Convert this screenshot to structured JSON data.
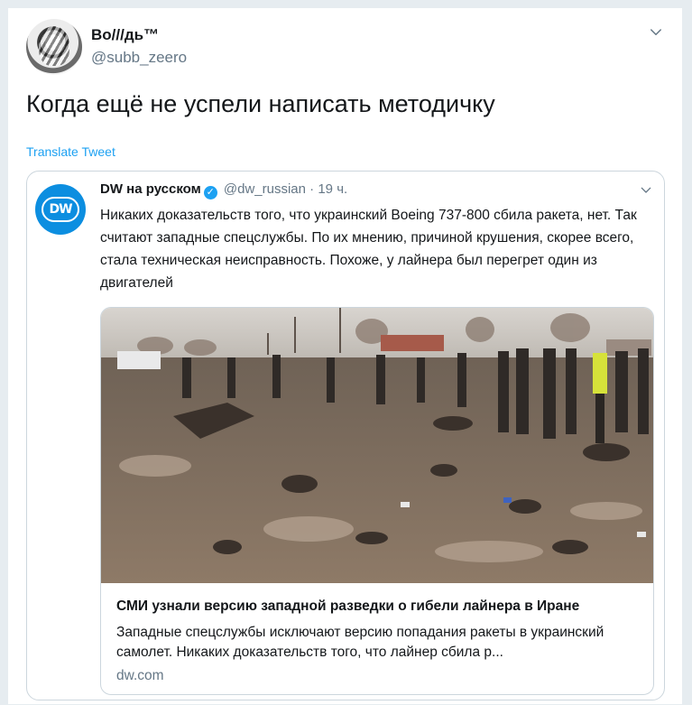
{
  "user": {
    "display_name": "Во///дь™",
    "handle": "@subb_zeero"
  },
  "tweet": {
    "text": "Когда ещё не успели написать методичку",
    "translate_label": "Translate Tweet"
  },
  "quoted": {
    "name": "DW на русском",
    "handle": "@dw_russian",
    "separator": "·",
    "time": "19 ч.",
    "avatar_text": "DW",
    "text": "Никаких доказательств того, что украинский Boeing 737-800 сбила ракета, нет. Так считают западные спецслужбы. По их мнению, причиной крушения, скорее всего, стала техническая неисправность. Похоже, у лайнера был перегрет один из двигателей",
    "card": {
      "title": "СМИ узнали версию западной разведки о гибели лайнера в Иране",
      "description": "Западные спецслужбы исключают версию попадания ракеты в украинский самолет. Никаких доказательств того, что лайнер сбила р...",
      "domain": "dw.com"
    }
  },
  "colors": {
    "link": "#1da1f2",
    "muted": "#657786",
    "border": "#ccd6dd",
    "dw_blue": "#0c8ee0"
  },
  "icons": {
    "more": "chevron-down-icon",
    "verified": "verified-badge-icon"
  }
}
